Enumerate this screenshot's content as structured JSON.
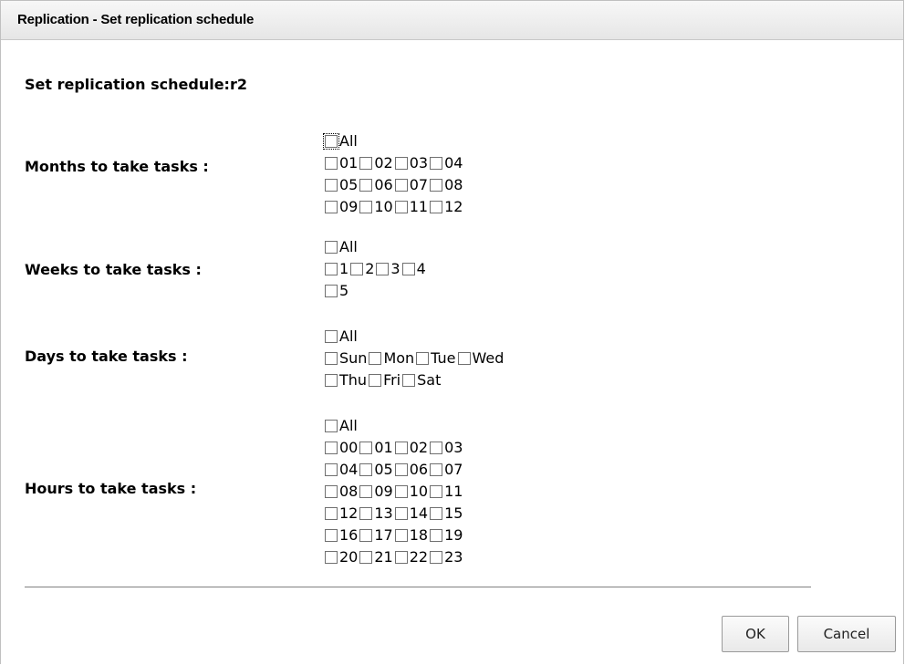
{
  "window": {
    "title": "Replication - Set replication schedule"
  },
  "heading": "Set replication schedule:r2",
  "months": {
    "label": "Months to take tasks :",
    "all_label": "All",
    "rows": [
      [
        "01",
        "02",
        "03",
        "04"
      ],
      [
        "05",
        "06",
        "07",
        "08"
      ],
      [
        "09",
        "10",
        "11",
        "12"
      ]
    ]
  },
  "weeks": {
    "label": "Weeks to take tasks :",
    "all_label": "All",
    "rows": [
      [
        "1",
        "2",
        "3",
        "4"
      ],
      [
        "5"
      ]
    ]
  },
  "days": {
    "label": "Days to take tasks :",
    "all_label": "All",
    "rows": [
      [
        "Sun",
        "Mon",
        "Tue",
        "Wed"
      ],
      [
        "Thu",
        "Fri",
        "Sat"
      ]
    ]
  },
  "hours": {
    "label": "Hours to take tasks :",
    "all_label": "All",
    "rows": [
      [
        "00",
        "01",
        "02",
        "03"
      ],
      [
        "04",
        "05",
        "06",
        "07"
      ],
      [
        "08",
        "09",
        "10",
        "11"
      ],
      [
        "12",
        "13",
        "14",
        "15"
      ],
      [
        "16",
        "17",
        "18",
        "19"
      ],
      [
        "20",
        "21",
        "22",
        "23"
      ]
    ]
  },
  "buttons": {
    "ok": "OK",
    "cancel": "Cancel"
  }
}
